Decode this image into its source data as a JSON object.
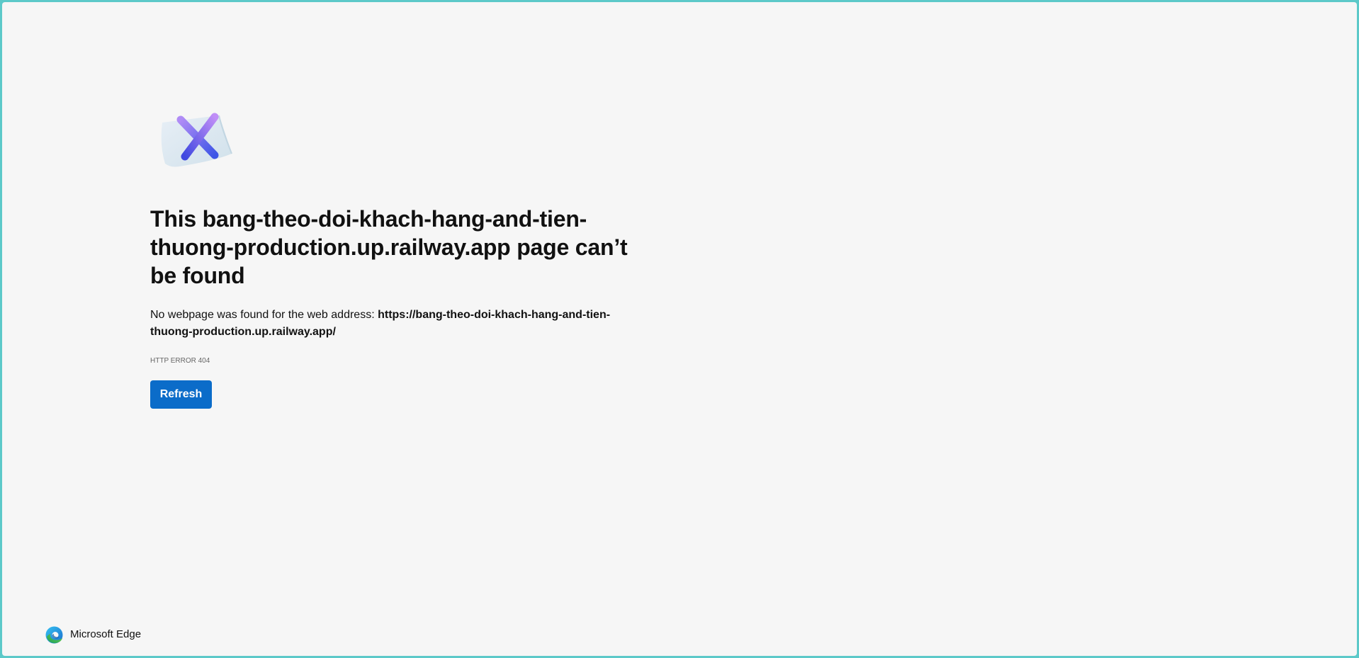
{
  "page": {
    "title": "This bang-theo-doi-khach-hang-and-tien-thuong-production.up.railway.app page can’t be found",
    "description_prefix": "No webpage was found for the web address: ",
    "description_url": "https://bang-theo-doi-khach-hang-and-tien-thuong-production.up.railway.app/",
    "error_code": "HTTP ERROR 404",
    "refresh_label": "Refresh"
  },
  "brand": {
    "name": "Microsoft Edge",
    "icon": "edge-logo-icon"
  },
  "icons": {
    "error": "page-error-x-icon"
  },
  "colors": {
    "background": "#f6f6f6",
    "frame": "#5cc9c9",
    "button": "#0b6cc9",
    "button_text": "#ffffff",
    "text": "#111111",
    "muted": "#666666"
  }
}
